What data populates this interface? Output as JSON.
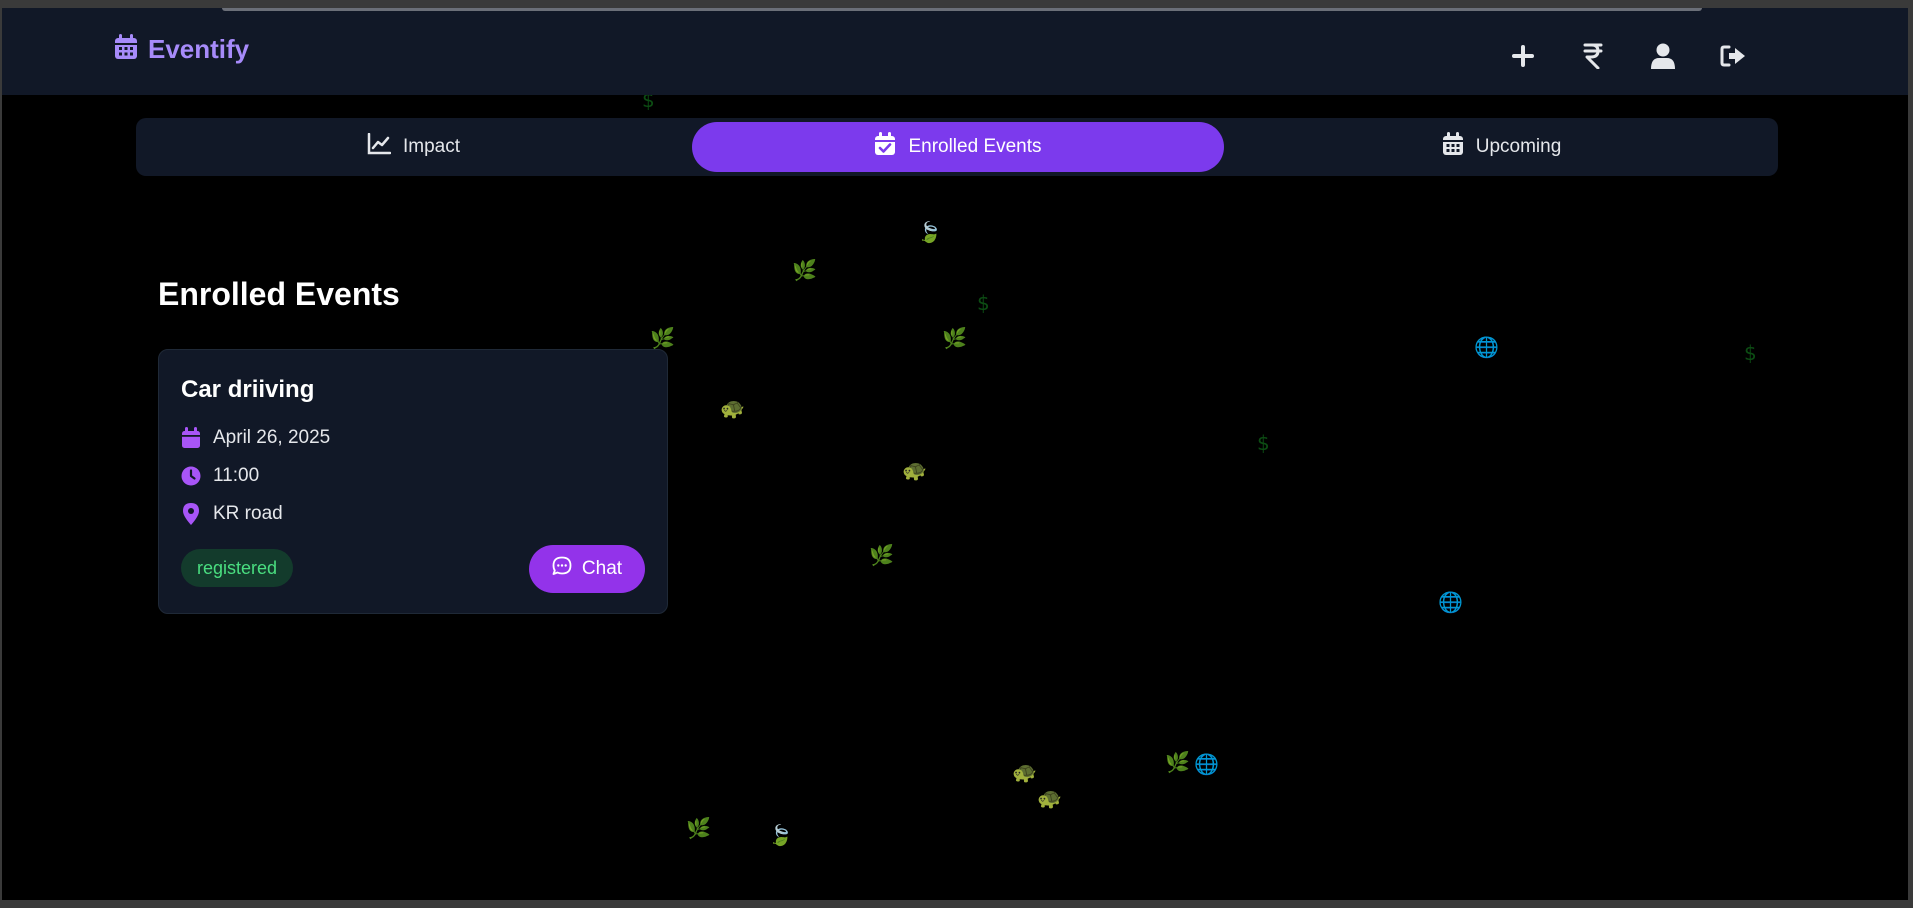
{
  "app": {
    "brand": "Eventify",
    "brand_color": "#a78bfa",
    "accent_color": "#7c3aed"
  },
  "nav_actions": [
    {
      "icon": "plus-icon"
    },
    {
      "icon": "rupee-icon"
    },
    {
      "icon": "user-icon"
    },
    {
      "icon": "logout-icon"
    }
  ],
  "tabs": [
    {
      "label": "Impact",
      "icon": "chart-line-icon",
      "active": false
    },
    {
      "label": "Enrolled Events",
      "icon": "calendar-check-icon",
      "active": true
    },
    {
      "label": "Upcoming",
      "icon": "calendar-icon",
      "active": false
    }
  ],
  "section": {
    "title": "Enrolled Events"
  },
  "events": [
    {
      "title": "Car driiving",
      "date": "April 26, 2025",
      "time": "11:00",
      "location": "KR road",
      "status": "registered",
      "chat_label": "Chat"
    }
  ]
}
